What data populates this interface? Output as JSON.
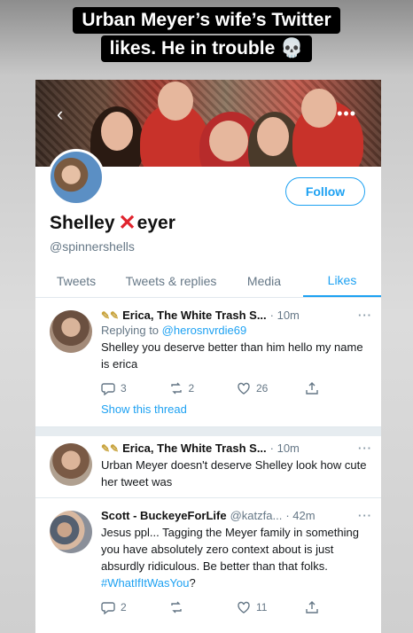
{
  "caption": {
    "line1": "Urban Meyer’s wife’s Twitter",
    "line2": "likes. He in trouble",
    "emoji": "💀"
  },
  "banner": {
    "back_icon": "‹",
    "more_icon": "•••"
  },
  "profile": {
    "name_start": "Shelley ",
    "name_x": "✕",
    "name_end": "eyer",
    "handle": "@spinnershells",
    "follow_label": "Follow"
  },
  "tabs": [
    {
      "label": "Tweets"
    },
    {
      "label": "Tweets & replies"
    },
    {
      "label": "Media"
    },
    {
      "label": "Likes"
    }
  ],
  "tweets": [
    {
      "emoji": "✎✎",
      "author": "Erica, The White Trash S...",
      "time": "· 10m",
      "more": "···",
      "reply_label": "Replying to ",
      "reply_handle": "@herosnvrdie69",
      "text": "Shelley you deserve better than him hello my name is erica",
      "replies": "3",
      "retweets": "2",
      "likes": "26",
      "show_thread": "Show this thread"
    },
    {
      "emoji": "✎✎",
      "author": "Erica, The White Trash S...",
      "time": "· 10m",
      "more": "···",
      "text": "Urban Meyer doesn't deserve Shelley look how cute her tweet was"
    },
    {
      "author": "Scott - BuckeyeForLife",
      "handle": "@katzfa...",
      "time": "· 42m",
      "more": "···",
      "text": "Jesus ppl... Tagging the Meyer family in something you have absolutely zero context about is just absurdly ridiculous. Be better than that folks. ",
      "hashtag": "#WhatIfItWasYou",
      "text_end": "?",
      "replies": "2",
      "retweets": "",
      "likes": "11"
    }
  ],
  "colors": {
    "accent": "#1da1f2",
    "red_x": "#e0242e",
    "muted": "#657786"
  }
}
